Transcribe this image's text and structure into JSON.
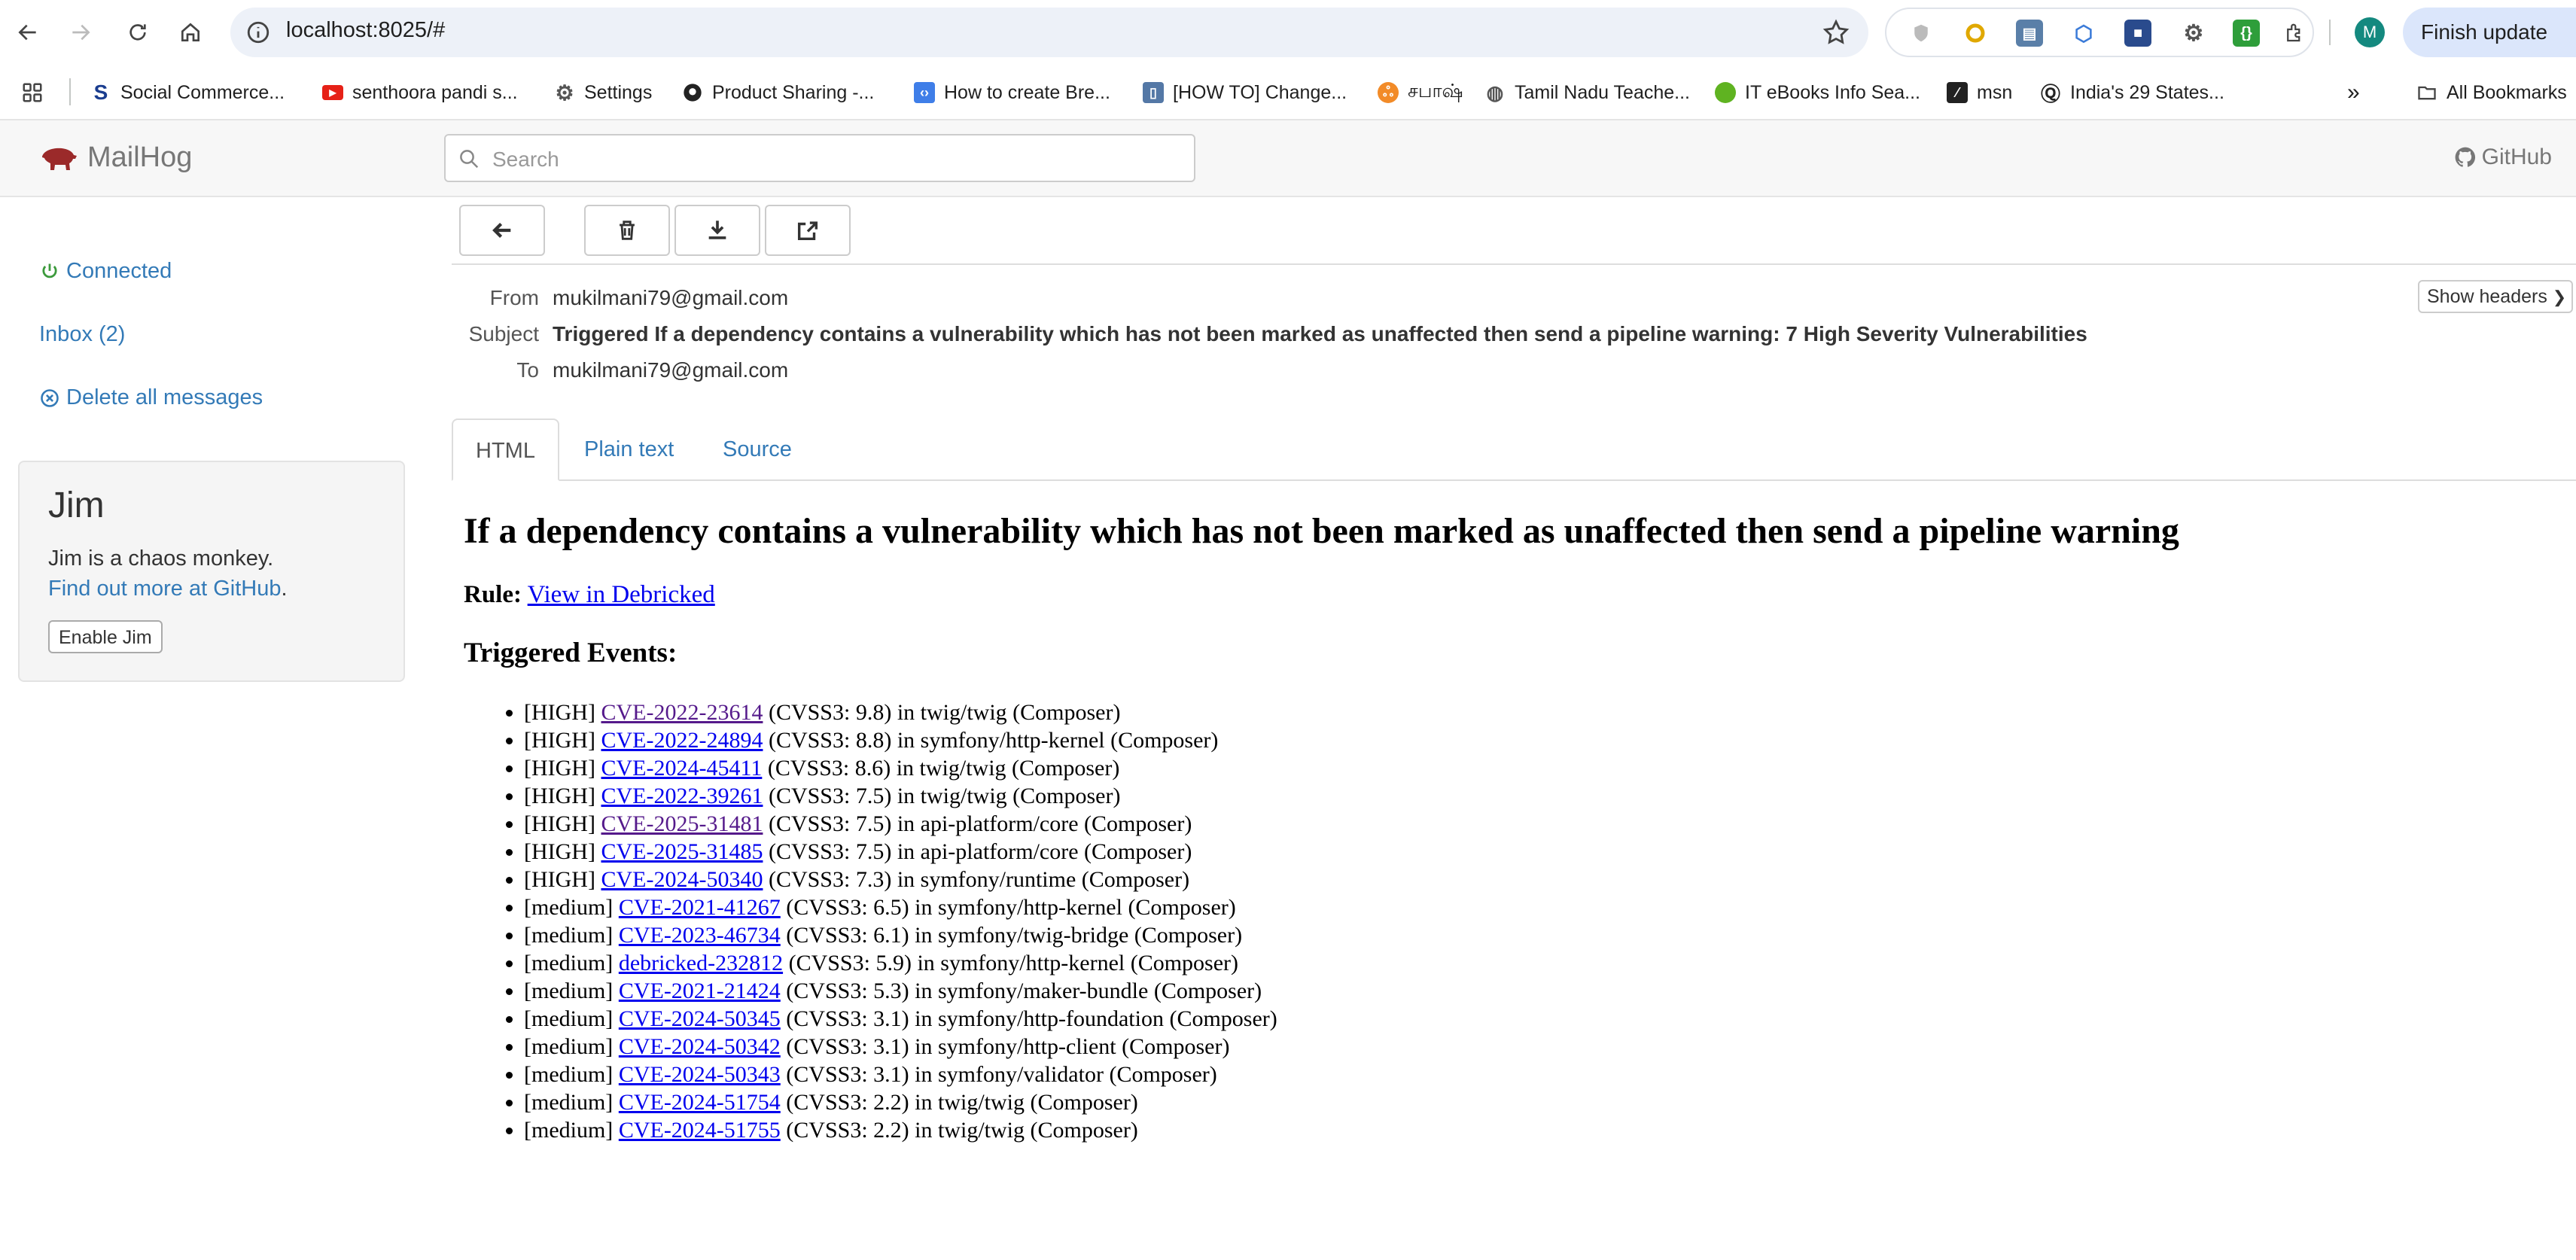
{
  "browser": {
    "url": "localhost:8025/#",
    "finish_update": "Finish update",
    "profile_initial": "M",
    "bookmarks": [
      {
        "label": "Social Commerce...",
        "icon": "s-logo-icon"
      },
      {
        "label": "senthoora pandi s...",
        "icon": "youtube-icon"
      },
      {
        "label": "Settings",
        "icon": "gear-icon"
      },
      {
        "label": "Product Sharing -...",
        "icon": "github-icon"
      },
      {
        "label": "How to create Bre...",
        "icon": "tag-icon"
      },
      {
        "label": "[HOW TO] Change...",
        "icon": "site-icon"
      },
      {
        "label": "சபாஷ்",
        "icon": "site-icon"
      },
      {
        "label": "Tamil Nadu Teache...",
        "icon": "globe-icon"
      },
      {
        "label": "IT eBooks Info Sea...",
        "icon": "green-dot-icon"
      },
      {
        "label": "msn",
        "icon": "msn-icon"
      },
      {
        "label": "India's 29 States...",
        "icon": "quora-icon"
      }
    ],
    "all_bookmarks": "All Bookmarks"
  },
  "app": {
    "brand": "MailHog",
    "search_placeholder": "Search",
    "github": "GitHub"
  },
  "sidebar": {
    "connected": "Connected",
    "inbox": "Inbox (2)",
    "delete_all": "Delete all messages"
  },
  "jim": {
    "title": "Jim",
    "desc": "Jim is a chaos monkey.",
    "find_out": "Find out more at GitHub",
    "find_suffix": ".",
    "button": "Enable Jim"
  },
  "message": {
    "from_label": "From",
    "from": "mukilmani79@gmail.com",
    "subject_label": "Subject",
    "subject": "Triggered If a dependency contains a vulnerability which has not been marked as unaffected then send a pipeline warning: 7 High Severity Vulnerabilities",
    "to_label": "To",
    "to": "mukilmani79@gmail.com",
    "show_headers": "Show headers"
  },
  "tabs": [
    "HTML",
    "Plain text",
    "Source"
  ],
  "email": {
    "heading": "If a dependency contains a vulnerability which has not been marked as unaffected then send a pipeline warning",
    "rule_label": "Rule:",
    "rule_link": "View in Debricked",
    "events_heading": "Triggered Events:",
    "events": [
      {
        "severity": "[HIGH]",
        "id": "CVE-2022-23614",
        "rest": "(CVSS3: 9.8) in twig/twig (Composer)"
      },
      {
        "severity": "[HIGH]",
        "id": "CVE-2022-24894",
        "rest": "(CVSS3: 8.8) in symfony/http-kernel (Composer)"
      },
      {
        "severity": "[HIGH]",
        "id": "CVE-2024-45411",
        "rest": "(CVSS3: 8.6) in twig/twig (Composer)"
      },
      {
        "severity": "[HIGH]",
        "id": "CVE-2022-39261",
        "rest": "(CVSS3: 7.5) in twig/twig (Composer)"
      },
      {
        "severity": "[HIGH]",
        "id": "CVE-2025-31481",
        "rest": "(CVSS3: 7.5) in api-platform/core (Composer)"
      },
      {
        "severity": "[HIGH]",
        "id": "CVE-2025-31485",
        "rest": "(CVSS3: 7.5) in api-platform/core (Composer)"
      },
      {
        "severity": "[HIGH]",
        "id": "CVE-2024-50340",
        "rest": "(CVSS3: 7.3) in symfony/runtime (Composer)"
      },
      {
        "severity": "[medium]",
        "id": "CVE-2021-41267",
        "rest": "(CVSS3: 6.5) in symfony/http-kernel (Composer)"
      },
      {
        "severity": "[medium]",
        "id": "CVE-2023-46734",
        "rest": "(CVSS3: 6.1) in symfony/twig-bridge (Composer)"
      },
      {
        "severity": "[medium]",
        "id": "debricked-232812",
        "rest": "(CVSS3: 5.9) in symfony/http-kernel (Composer)"
      },
      {
        "severity": "[medium]",
        "id": "CVE-2021-21424",
        "rest": "(CVSS3: 5.3) in symfony/maker-bundle (Composer)"
      },
      {
        "severity": "[medium]",
        "id": "CVE-2024-50345",
        "rest": "(CVSS3: 3.1) in symfony/http-foundation (Composer)"
      },
      {
        "severity": "[medium]",
        "id": "CVE-2024-50342",
        "rest": "(CVSS3: 3.1) in symfony/http-client (Composer)"
      },
      {
        "severity": "[medium]",
        "id": "CVE-2024-50343",
        "rest": "(CVSS3: 3.1) in symfony/validator (Composer)"
      },
      {
        "severity": "[medium]",
        "id": "CVE-2024-51754",
        "rest": "(CVSS3: 2.2) in twig/twig (Composer)"
      },
      {
        "severity": "[medium]",
        "id": "CVE-2024-51755",
        "rest": "(CVSS3: 2.2) in twig/twig (Composer)"
      }
    ]
  }
}
